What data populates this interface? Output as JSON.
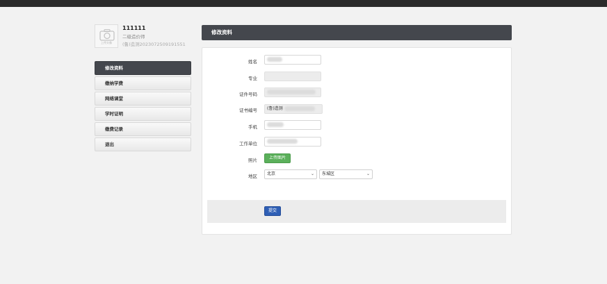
{
  "profile": {
    "avatar_caption": "上传头像",
    "name": "111111",
    "title": "二级造价师",
    "code": "(鲁)造测2023072509191551"
  },
  "nav": {
    "items": [
      {
        "label": "修改资料"
      },
      {
        "label": "缴纳学费"
      },
      {
        "label": "网络课堂"
      },
      {
        "label": "学时证明"
      },
      {
        "label": "缴费记录"
      },
      {
        "label": "退出"
      }
    ]
  },
  "panel": {
    "title": "修改资料"
  },
  "form": {
    "name_label": "姓名",
    "major_label": "专业",
    "id_label": "证件号码",
    "cert_label": "证书编号",
    "cert_prefix": "(鲁)造测",
    "phone_label": "手机",
    "company_label": "工作单位",
    "photo_label": "照片",
    "upload_label": "上传图片",
    "region_label": "地区",
    "province": "北京",
    "district": "东城区",
    "submit_label": "提交"
  }
}
